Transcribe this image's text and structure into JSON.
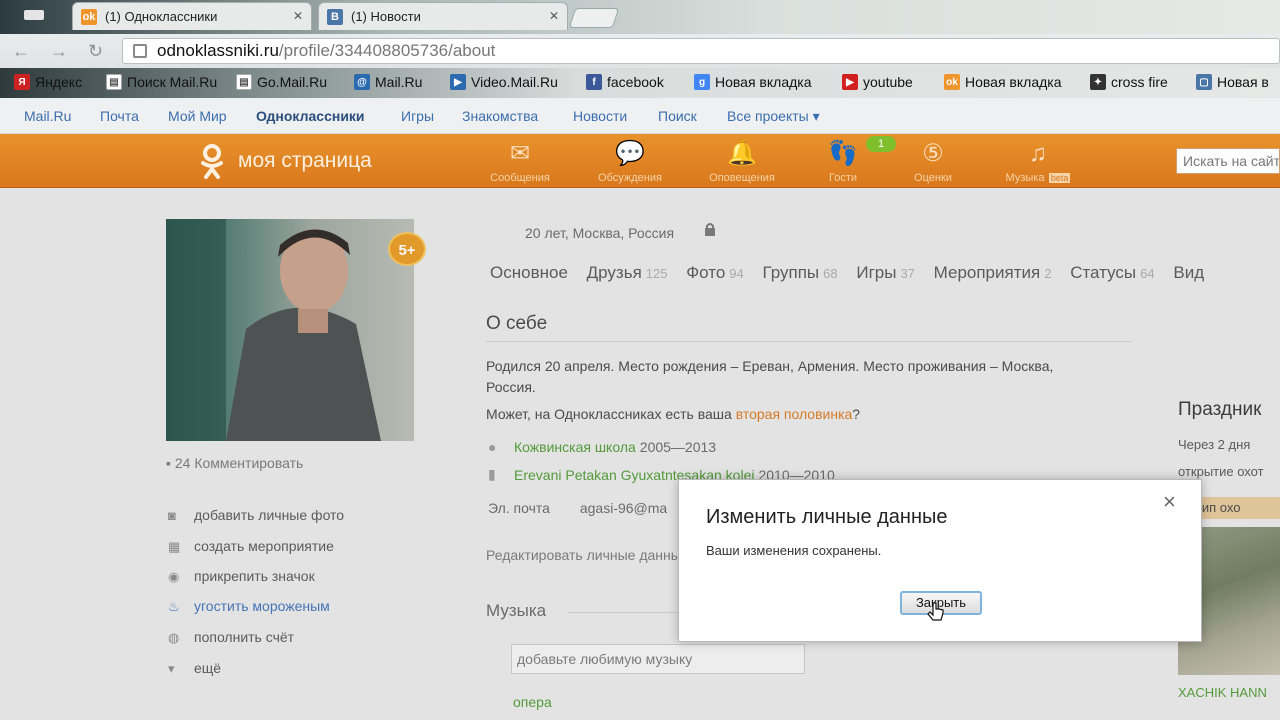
{
  "browser": {
    "tabs": [
      {
        "title": "(1) Одноклассники",
        "favicon_color": "#f0952c",
        "favicon_glyph": "ok-logo-icon"
      },
      {
        "title": "(1) Новости",
        "favicon_color": "#4a76a8",
        "favicon_glyph": "В"
      }
    ],
    "url_host": "odnoklassniki.ru",
    "url_path": "/profile/334408805736/about",
    "bookmarks": [
      {
        "label": "Яндекс",
        "color": "#cc2222",
        "glyph": "Я"
      },
      {
        "label": "Поиск Mail.Ru",
        "color": "#4a76a8",
        "glyph": "@"
      },
      {
        "label": "Go.Mail.Ru",
        "color": "#4a76a8",
        "glyph": "@"
      },
      {
        "label": "Mail.Ru",
        "color": "#2c6ab0",
        "glyph": "@"
      },
      {
        "label": "Video.Mail.Ru",
        "color": "#2c6ab0",
        "glyph": "▶"
      },
      {
        "label": "facebook",
        "color": "#3b5998",
        "glyph": "f"
      },
      {
        "label": "Новая вкладка",
        "color": "#4285f4",
        "glyph": "g"
      },
      {
        "label": "youtube",
        "color": "#d21f1f",
        "glyph": "▶"
      },
      {
        "label": "Новая вкладка",
        "color": "#f0952c",
        "glyph": "ok"
      },
      {
        "label": "cross fire",
        "color": "#333333",
        "glyph": "✦"
      },
      {
        "label": "Новая в",
        "color": "#4a76a8",
        "glyph": "▢"
      }
    ]
  },
  "mailnav": {
    "items": [
      "Mail.Ru",
      "Почта",
      "Мой Мир",
      "Одноклассники",
      "Игры",
      "Знакомства",
      "Новости",
      "Поиск",
      "Все проекты ▾"
    ]
  },
  "okbar": {
    "brand": "моя страница",
    "icons": [
      {
        "label": "Сообщения",
        "icon": "envelope-icon"
      },
      {
        "label": "Обсуждения",
        "icon": "chat-icon"
      },
      {
        "label": "Оповещения",
        "icon": "bell-icon"
      },
      {
        "label": "Гости",
        "icon": "footprints-icon"
      },
      {
        "label": "Оценки",
        "icon": "rating-icon"
      },
      {
        "label": "Музыка",
        "icon": "music-icon"
      }
    ],
    "guests_badge": "1",
    "music_badge": "beta",
    "search_placeholder": "Искать на сайте"
  },
  "profile": {
    "age_badge": "5+",
    "comments": "24 Комментировать",
    "actions": [
      {
        "label": "добавить личные фото",
        "icon": "camera-icon"
      },
      {
        "label": "создать мероприятие",
        "icon": "calendar-icon"
      },
      {
        "label": "прикрепить значок",
        "icon": "badge-icon"
      },
      {
        "label": "угостить мороженым",
        "icon": "icecream-icon"
      },
      {
        "label": "пополнить счёт",
        "icon": "coin-icon"
      },
      {
        "label": "ещё",
        "icon": "chevron-down-icon"
      }
    ],
    "geo": "20 лет, Москва, Россия",
    "tabs": [
      {
        "label": "Основное",
        "count": ""
      },
      {
        "label": "Друзья",
        "count": "125"
      },
      {
        "label": "Фото",
        "count": "94"
      },
      {
        "label": "Группы",
        "count": "68"
      },
      {
        "label": "Игры",
        "count": "37"
      },
      {
        "label": "Мероприятия",
        "count": "2"
      },
      {
        "label": "Статусы",
        "count": "64"
      },
      {
        "label": "Вид",
        "count": ""
      }
    ]
  },
  "about": {
    "title": "О себе",
    "bio_line1": "Родился 20 апреля. Место рождения – Ереван, Армения. Место проживания – Москва,",
    "bio_line2": "Россия.",
    "soulmate_prefix": "Может, на Одноклассниках есть ваша ",
    "soulmate_link": "вторая половинка",
    "soulmate_suffix": "?",
    "school": "Кожвинская школа",
    "school_years": "2005—2013",
    "college": "Erevani Petakan Gyuxatntesakan kolej",
    "college_years": "2010—2010",
    "email_label": "Эл. почта",
    "email_value": "agasi-96@ma",
    "edit_link": "Редактировать личные данные",
    "music_title": "Музыка",
    "music_placeholder": "добавьте любимую музыку",
    "music_genre": "опера"
  },
  "sidebar_right": {
    "title": "Праздник",
    "when": "Через 2 дня",
    "event": "открытие охот",
    "stripe": "инцип охо",
    "friend": "XACHIK HANN"
  },
  "modal": {
    "title": "Изменить личные данные",
    "message": "Ваши изменения сохранены.",
    "close_button": "Закрыть",
    "close_icon": "×"
  }
}
